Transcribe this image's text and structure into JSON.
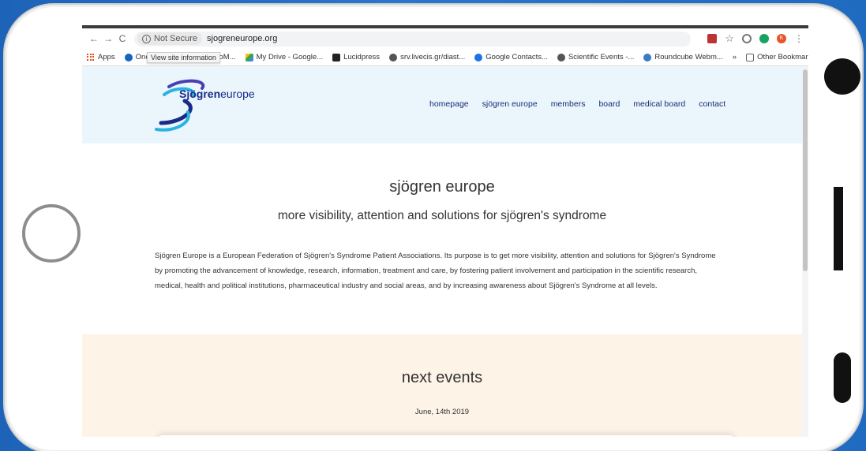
{
  "browser": {
    "security_label": "Not Secure",
    "url": "sjogreneurope.org",
    "tooltip": "View site information",
    "bookmarks": [
      "Apps",
      "One",
      "d | CoM...",
      "My Drive - Google...",
      "Lucidpress",
      "srv.livecis.gr/diast...",
      "Google Contacts...",
      "Scientific Events -...",
      "Roundcube Webm..."
    ],
    "overflow": "»",
    "other_bookmarks": "Other Bookmarks",
    "profile_initial": "K"
  },
  "site": {
    "logo_bold": "Sjögren",
    "logo_light": "europe",
    "nav": [
      "homepage",
      "sjögren europe",
      "members",
      "board",
      "medical board",
      "contact"
    ]
  },
  "main": {
    "title": "sjögren europe",
    "subtitle": "more visibility, attention and solutions for sjögren's syndrome",
    "intro": "Sjögren Europe is a European Federation of Sjögren's Syndrome Patient Associations. Its purpose is to get more visibility, attention and solutions for Sjögren's Syndrome by promoting the advancement of knowledge, research, information, treatment and care, by fostering patient involvement and participation in the scientific research, medical, health and political institutions, pharmaceutical industry and social areas, and by increasing awareness about Sjögren's Syndrome at all levels."
  },
  "events": {
    "title": "next events",
    "date": "June, 14th 2019"
  },
  "colors": {
    "background": "#1f6bc0",
    "header_bg": "#eaf6fc",
    "events_bg": "#fdf3e7",
    "brand_navy": "#1a2a8a"
  }
}
